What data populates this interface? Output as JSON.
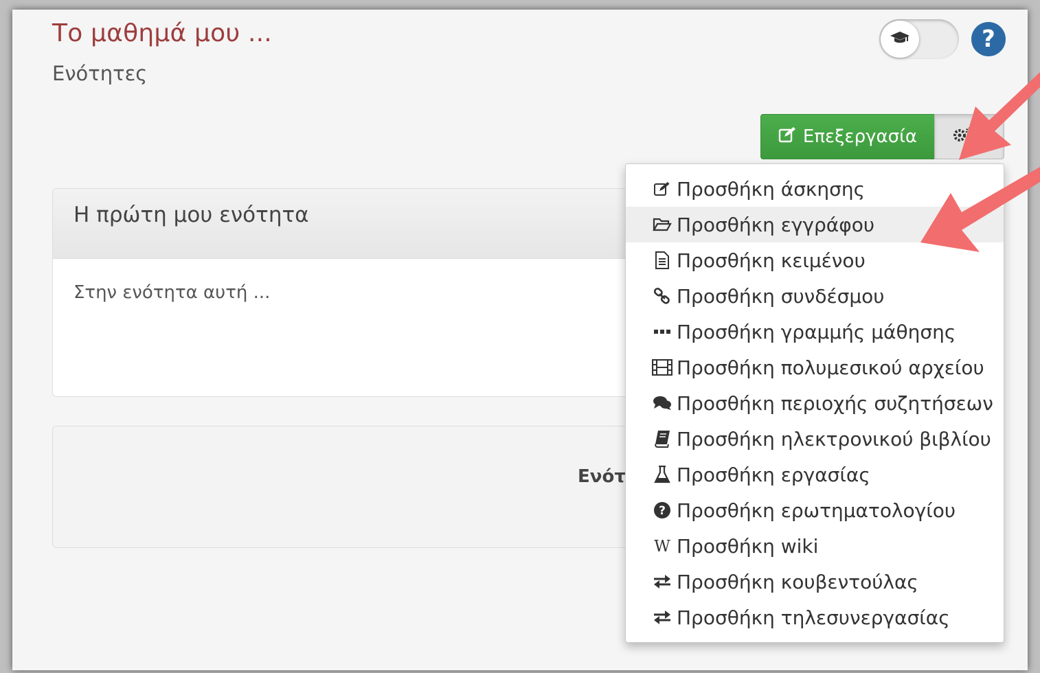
{
  "page": {
    "title": "Το μαθημά μου ...",
    "subtitle": "Ενότητες"
  },
  "toolbar": {
    "edit_label": "Επεξεργασία"
  },
  "section": {
    "title": "Η πρώτη μου ενότητα",
    "description": "Στην ενότητα αυτή ..."
  },
  "add_section": {
    "label_visible": "Ενότ"
  },
  "dropdown": {
    "items": [
      {
        "label": "Προσθήκη άσκησης",
        "icon": "edit-icon"
      },
      {
        "label": "Προσθήκη εγγράφου",
        "icon": "folder-open-icon",
        "active": true
      },
      {
        "label": "Προσθήκη κειμένου",
        "icon": "file-text-icon"
      },
      {
        "label": "Προσθήκη συνδέσμου",
        "icon": "link-icon"
      },
      {
        "label": "Προσθήκη γραμμής μάθησης",
        "icon": "ellipsis-icon"
      },
      {
        "label": "Προσθήκη πολυμεσικού αρχείου",
        "icon": "film-icon"
      },
      {
        "label": "Προσθήκη περιοχής συζητήσεων",
        "icon": "comments-icon"
      },
      {
        "label": "Προσθήκη ηλεκτρονικού βιβλίου",
        "icon": "book-icon"
      },
      {
        "label": "Προσθήκη εργασίας",
        "icon": "flask-icon"
      },
      {
        "label": "Προσθήκη ερωτηματολογίου",
        "icon": "question-circle-icon"
      },
      {
        "label": "Προσθήκη wiki",
        "icon": "wikipedia-icon"
      },
      {
        "label": "Προσθήκη κουβεντούλας",
        "icon": "exchange-icon"
      },
      {
        "label": "Προσθήκη τηλεσυνεργασίας",
        "icon": "exchange-icon"
      }
    ]
  },
  "colors": {
    "title": "#9e3d3d",
    "edit_button": "#46a646",
    "help": "#2c6aa6",
    "annotation_arrow": "#f26d6d"
  }
}
